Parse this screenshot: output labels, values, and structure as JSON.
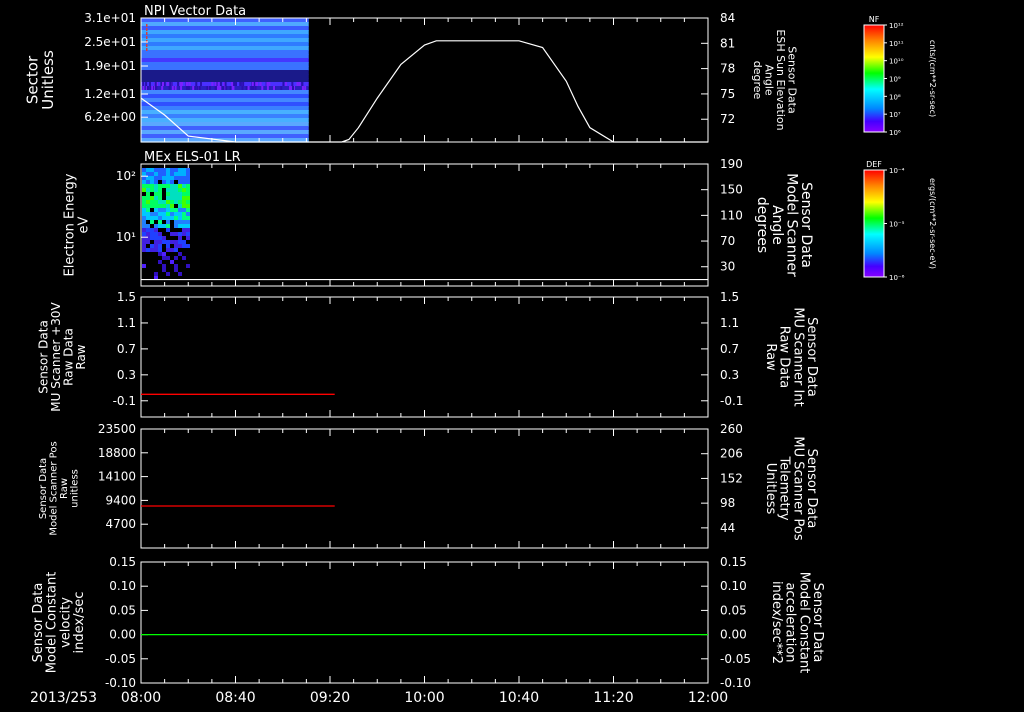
{
  "figure": {
    "date_label": "2013/253",
    "time_ticks": [
      "08:00",
      "08:40",
      "09:20",
      "10:00",
      "10:40",
      "11:20",
      "12:00"
    ]
  },
  "colors": {
    "background": "#000000",
    "axes": "#ffffff",
    "red_trace": "#ff0000",
    "green_trace": "#00ff00"
  },
  "chart_data": [
    {
      "type": "heatmap",
      "title": "NPI Vector Data",
      "ylabel": "Sector\nUnitless",
      "yticks": [
        "3.1e+01",
        "2.5e+01",
        "1.9e+01",
        "1.2e+01",
        "6.2e+00"
      ],
      "ylim": [
        0,
        31
      ],
      "data_x_range": [
        "08:00",
        "09:11"
      ],
      "colorbar": {
        "label": "NF",
        "units": "cnts/(cm**2-sr-sec)",
        "ticks": [
          "10¹²",
          "10¹¹",
          "10¹⁰",
          "10⁹",
          "10⁸",
          "10⁷",
          "10⁶"
        ]
      },
      "overlay": {
        "name": "Sensor Data ESH Sun Elevation Angle",
        "right_label": "Sensor Data\nESH Sun Elevation\nAngle\ndegree",
        "right_ticks": [
          "84",
          "81",
          "78",
          "75",
          "72"
        ],
        "right_ylim": [
          69.3,
          84
        ],
        "x": [
          "08:00",
          "08:10",
          "08:20",
          "08:40",
          "09:00",
          "09:20",
          "09:25",
          "09:28",
          "09:32",
          "09:40",
          "09:50",
          "10:00",
          "10:05",
          "10:20",
          "10:40",
          "10:50",
          "11:00",
          "11:05",
          "11:10",
          "11:20",
          "12:00"
        ],
        "y": [
          74.5,
          72.5,
          70.0,
          69.3,
          69.3,
          69.3,
          69.3,
          69.6,
          71.0,
          74.5,
          78.5,
          80.8,
          81.3,
          81.3,
          81.3,
          80.5,
          76.5,
          73.5,
          71.0,
          69.3,
          69.3
        ]
      }
    },
    {
      "type": "heatmap",
      "title": "MEx ELS-01 LR",
      "ylabel": "Electron Energy\neV",
      "yticks": [
        "10²",
        "10¹"
      ],
      "ylim_log10": [
        0.2,
        2.2
      ],
      "data_x_range": [
        "08:00",
        "08:20"
      ],
      "colorbar": {
        "label": "DEF",
        "units": "ergs/(cm**2-sr-sec-eV)",
        "ticks": [
          "10⁻⁴",
          "10⁻⁵",
          "10⁻⁶"
        ]
      },
      "overlay": {
        "name": "Sensor Data Model Scanner Angle",
        "right_label": "Sensor Data\nModel Scanner\nAngle\ndegrees",
        "right_ticks": [
          "190",
          "150",
          "110",
          "70",
          "30"
        ],
        "right_ylim": [
          0,
          190
        ],
        "x": [
          "08:00",
          "12:00"
        ],
        "y": [
          10,
          10
        ]
      }
    },
    {
      "type": "line",
      "ylabel": "Sensor Data\nMU Scanner +30V\nRaw Data\nRaw",
      "yticks": [
        "1.5",
        "1.1",
        "0.7",
        "0.3",
        "-0.1"
      ],
      "ylim": [
        -0.35,
        1.5
      ],
      "right_label": "Sensor Data\nMU Scanner Int\nRaw Data\nRaw",
      "right_label_color": "#ff0000",
      "right_ticks": [
        "1.5",
        "1.1",
        "0.7",
        "0.3",
        "-0.1"
      ],
      "series": [
        {
          "color": "#ff0000",
          "x": [
            "08:00",
            "09:22"
          ],
          "values": [
            0.0,
            0.0
          ]
        }
      ]
    },
    {
      "type": "line",
      "ylabel": "Sensor Data\nModel Scanner Pos\nRaw\nunitless",
      "yticks": [
        "23500",
        "18800",
        "14100",
        "9400",
        "4700"
      ],
      "ylim": [
        0,
        23500
      ],
      "right_label": "Sensor Data\nMU Scanner Pos\nTelemetry\nUnitless",
      "right_label_color": "#ff0000",
      "right_ticks": [
        "260",
        "206",
        "152",
        "98",
        "44"
      ],
      "series": [
        {
          "color": "#ff0000",
          "x": [
            "08:00",
            "09:22"
          ],
          "values": [
            8300,
            8300
          ]
        }
      ]
    },
    {
      "type": "line",
      "ylabel": "Sensor Data\nModel Constant\nvelocity\nindex/sec",
      "yticks": [
        "0.15",
        "0.10",
        "0.05",
        "0.00",
        "-0.05",
        "-0.10"
      ],
      "ylim": [
        -0.1,
        0.15
      ],
      "right_label": "Sensor Data\nModel Constant\nacceleration\nindex/sec**2",
      "right_label_color": "#00ff00",
      "right_ticks": [
        "0.15",
        "0.10",
        "0.05",
        "0.00",
        "-0.05",
        "-0.10"
      ],
      "series": [
        {
          "color": "#00ff00",
          "x": [
            "08:00",
            "12:00"
          ],
          "values": [
            0.0,
            0.0
          ]
        }
      ]
    }
  ]
}
